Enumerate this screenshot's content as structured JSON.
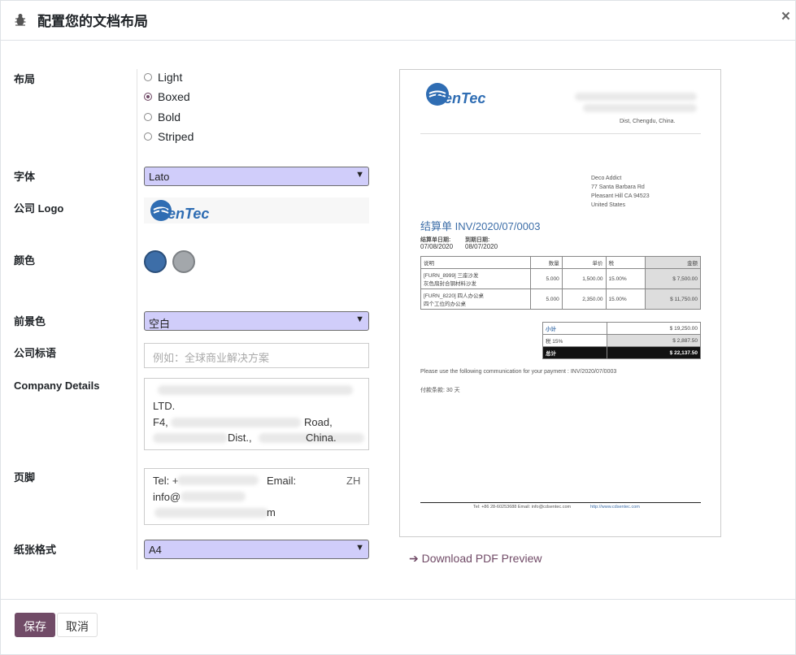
{
  "header": {
    "title": "配置您的文档布局",
    "icon": "bug-icon",
    "close": "×"
  },
  "fields": {
    "layout_label": "布局",
    "layout_options": [
      "Light",
      "Boxed",
      "Bold",
      "Striped"
    ],
    "layout_selected": "Boxed",
    "font_label": "字体",
    "font_value": "Lato",
    "logo_label": "公司 Logo",
    "color_label": "颜色",
    "colors": [
      "#3d6ea8",
      "#a3a7ab"
    ],
    "background_label": "前景色",
    "background_value": "空白",
    "tagline_label": "公司标语",
    "tagline_placeholder": "例如：全球商业解决方案",
    "company_details_label": "Company Details",
    "company_details_lines": [
      "LTD.",
      "F4,",
      "Road,",
      "Dist.,",
      "China."
    ],
    "footer_label": "页脚",
    "footer_lines": [
      "Tel: +",
      "Email:",
      "info@",
      "m"
    ],
    "footer_lang": "ZH",
    "paper_label": "纸张格式",
    "paper_value": "A4"
  },
  "logo": {
    "text": "SenTec"
  },
  "preview": {
    "company_addr": "Dist, Chengdu, China.",
    "customer": [
      "Deco Addict",
      "77 Santa Barbara Rd",
      "Pleasant Hill CA 94523",
      "United States"
    ],
    "invoice_title": "结算单 INV/2020/07/0003",
    "date_labels": [
      "结算单日期:",
      "到期日期:"
    ],
    "dates": [
      "07/08/2020",
      "08/07/2020"
    ],
    "table_headers": [
      "说明",
      "数量",
      "单价",
      "税",
      "金额"
    ],
    "rows": [
      {
        "desc1": "[FURN_8999] 三座沙发",
        "desc2": "灰色扇封合钢材料沙发",
        "qty": "5.000",
        "price": "1,500.00",
        "tax": "15.00%",
        "amount": "$ 7,500.00"
      },
      {
        "desc1": "[FURN_8220] 四人办公桌",
        "desc2": "四个工位的办公桌",
        "qty": "5.000",
        "price": "2,350.00",
        "tax": "15.00%",
        "amount": "$ 11,750.00"
      }
    ],
    "subtotal_label": "小计",
    "subtotal": "$ 19,250.00",
    "tax_label": "税 15%",
    "tax": "$ 2,887.50",
    "total_label": "总计",
    "total": "$ 22,137.50",
    "payment_note": "Please use the following communication for your payment : INV/2020/07/0003",
    "terms": "付款条款:  30 天",
    "footer_text": "Tel: +86 28-60253688   Email: info@cdsentec.com",
    "footer_link": "http://www.cdsentec.com"
  },
  "download_label": "Download PDF Preview",
  "buttons": {
    "save": "保存",
    "cancel": "取消"
  }
}
